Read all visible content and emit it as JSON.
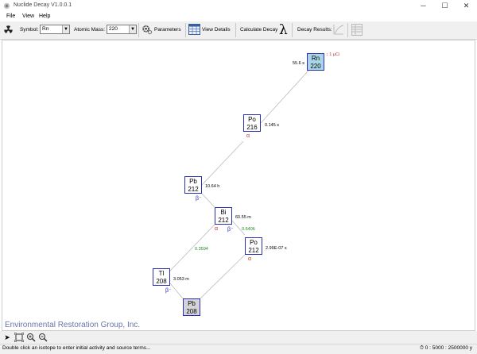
{
  "window": {
    "title": "Nuclide Decay V1.0.0.1",
    "minimize": "─",
    "maximize": "☐",
    "close": "✕"
  },
  "menu": [
    "File",
    "View",
    "Help"
  ],
  "toolbar": {
    "symbol_label": "Symbol:",
    "symbol_value": "Rn",
    "mass_label": "Atomic Mass:",
    "mass_value": "220",
    "parameters_label": "Parameters",
    "view_details_label": "View Details",
    "calc_decay_label": "Calculate Decay",
    "lambda_glyph": "λ",
    "decay_results_label": "Decay Results:"
  },
  "chain": {
    "nuclides": [
      {
        "symbol": "Rn",
        "mass": "220",
        "half_life": "55.6 s",
        "activity": "1 µCi",
        "state": "selected"
      },
      {
        "symbol": "Po",
        "mass": "216",
        "half_life": "0.145 s",
        "decay": "α"
      },
      {
        "symbol": "Pb",
        "mass": "212",
        "half_life": "10.64 h",
        "decay": "β⁻"
      },
      {
        "symbol": "Bi",
        "mass": "212",
        "half_life": "60.55 m",
        "decay": [
          "α",
          "β⁻"
        ]
      },
      {
        "symbol": "Po",
        "mass": "212",
        "half_life": "2.99E-07 s",
        "decay": "α"
      },
      {
        "symbol": "Tl",
        "mass": "208",
        "half_life": "3.053 m",
        "decay": "β⁻"
      },
      {
        "symbol": "Pb",
        "mass": "208",
        "state": "stable"
      }
    ],
    "branches": [
      "0.6406",
      "0.3594"
    ],
    "alpha_glyph": "α",
    "beta_glyph": "β⁻",
    "activity_prefix": "1"
  },
  "company": "Environmental Restoration Group, Inc.",
  "status": {
    "message": "Double click an isotope to enter initial activity and source terms...",
    "range": "0 : 5000 : 2500000 y"
  }
}
